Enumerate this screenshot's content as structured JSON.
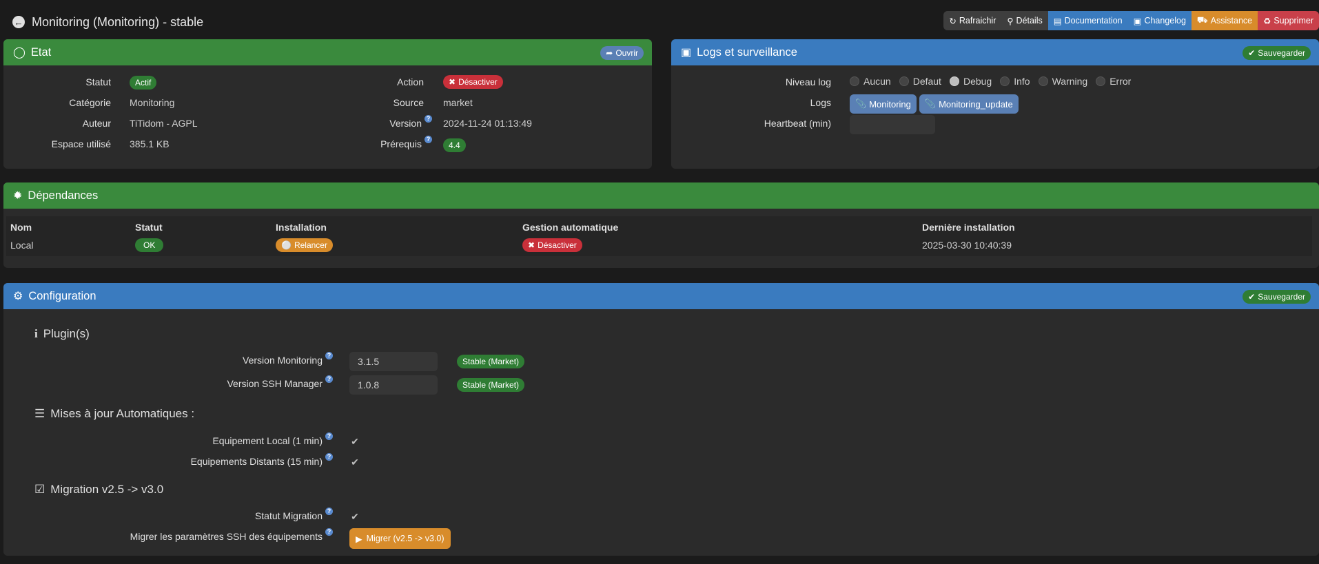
{
  "page": {
    "title": "Monitoring (Monitoring) - stable"
  },
  "toolbar": [
    {
      "label": "Rafraichir",
      "icon": "refresh-icon",
      "color": "#3e3e3e"
    },
    {
      "label": "Détails",
      "icon": "search-icon",
      "color": "#3e3e3e"
    },
    {
      "label": "Documentation",
      "icon": "book-icon",
      "color": "#3a7bbf"
    },
    {
      "label": "Changelog",
      "icon": "file-icon",
      "color": "#3a7bbf"
    },
    {
      "label": "Assistance",
      "icon": "truck-icon",
      "color": "#d88c2b"
    },
    {
      "label": "Supprimer",
      "icon": "trash-icon",
      "color": "#c9404a"
    }
  ],
  "etat": {
    "title": "Etat",
    "open_label": "Ouvrir",
    "statut_label": "Statut",
    "statut_value": "Actif",
    "categorie_label": "Catégorie",
    "categorie_value": "Monitoring",
    "auteur_label": "Auteur",
    "auteur_value": "TiTidom - AGPL",
    "espace_label": "Espace utilisé",
    "espace_value": "385.1 KB",
    "action_label": "Action",
    "action_value": "Désactiver",
    "source_label": "Source",
    "source_value": "market",
    "version_label": "Version",
    "version_value": "2024-11-24 01:13:49",
    "prerequis_label": "Prérequis",
    "prerequis_value": "4.4"
  },
  "logs": {
    "title": "Logs et surveillance",
    "save_label": "Sauvegarder",
    "niveau_label": "Niveau log",
    "levels": [
      "Aucun",
      "Defaut",
      "Debug",
      "Info",
      "Warning",
      "Error"
    ],
    "selected_level": "Debug",
    "logs_label": "Logs",
    "log_buttons": [
      "Monitoring",
      "Monitoring_update"
    ],
    "heartbeat_label": "Heartbeat (min)",
    "heartbeat_value": ""
  },
  "deps": {
    "title": "Dépendances",
    "headers": [
      "Nom",
      "Statut",
      "Installation",
      "Gestion automatique",
      "Dernière installation"
    ],
    "row": {
      "nom": "Local",
      "statut": "OK",
      "installation": "Relancer",
      "gestion": "Désactiver",
      "derniere": "2025-03-30 10:40:39"
    }
  },
  "config": {
    "title": "Configuration",
    "save_label": "Sauvegarder",
    "plugins_title": "Plugin(s)",
    "version_monitoring_label": "Version Monitoring",
    "version_monitoring_value": "3.1.5",
    "version_monitoring_badge": "Stable (Market)",
    "version_ssh_label": "Version SSH Manager",
    "version_ssh_value": "1.0.8",
    "version_ssh_badge": "Stable (Market)",
    "maj_title": "Mises à jour Automatiques :",
    "local_label": "Equipement Local (1 min)",
    "distants_label": "Equipements Distants (15 min)",
    "migration_title": "Migration v2.5 -> v3.0",
    "statut_migration_label": "Statut Migration",
    "migrer_label": "Migrer les paramètres SSH des équipements",
    "migrer_button": "Migrer (v2.5 -> v3.0)"
  }
}
